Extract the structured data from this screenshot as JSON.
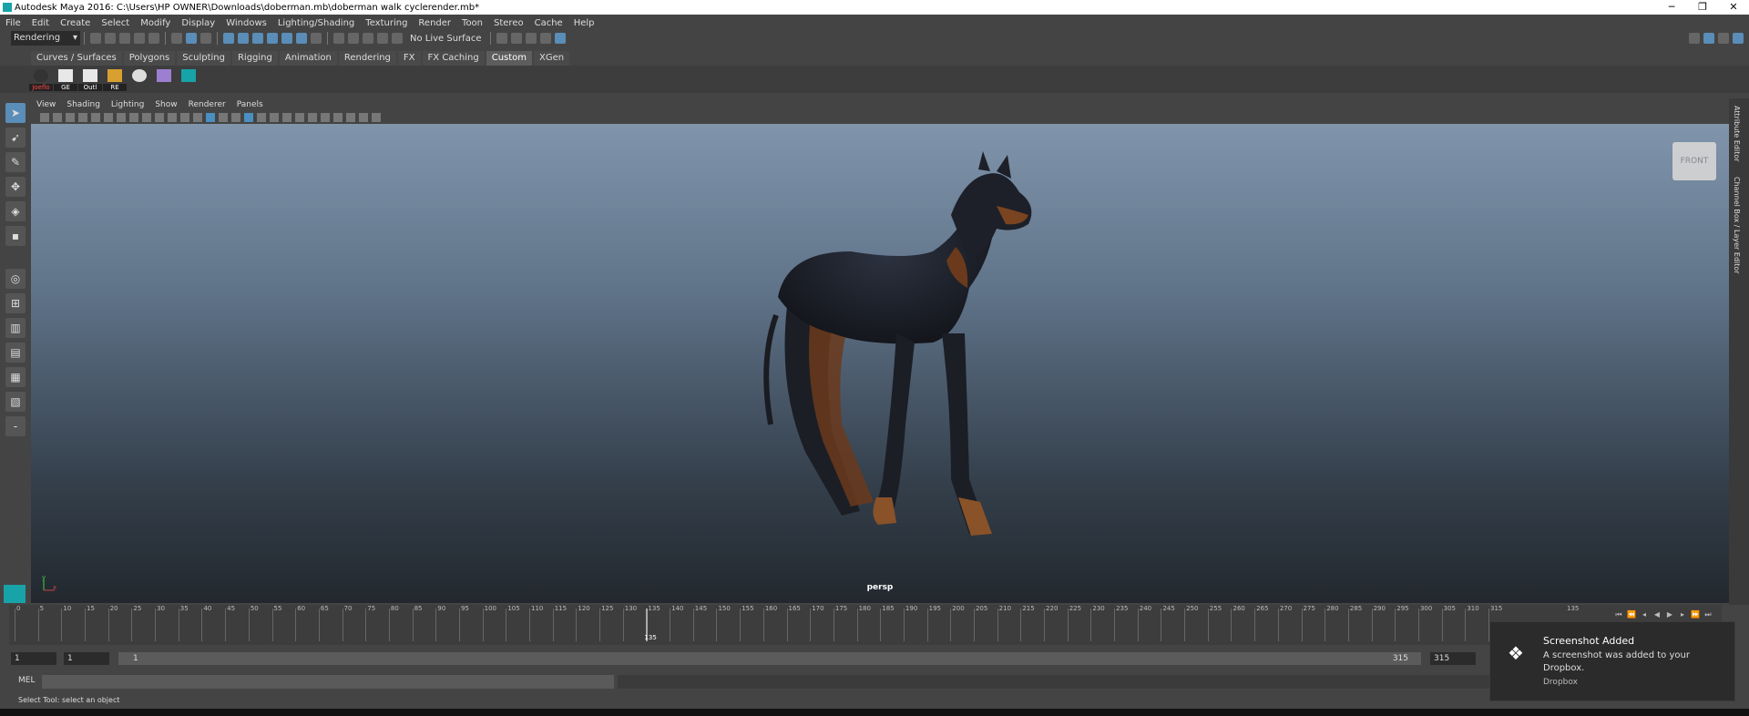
{
  "window": {
    "title": "Autodesk Maya 2016: C:\\Users\\HP OWNER\\Downloads\\doberman.mb\\doberman walk cyclerender.mb*",
    "controls": [
      "─",
      "❐",
      "✕"
    ]
  },
  "menubar": [
    "File",
    "Edit",
    "Create",
    "Select",
    "Modify",
    "Display",
    "Windows",
    "Lighting/Shading",
    "Texturing",
    "Render",
    "Toon",
    "Stereo",
    "Cache",
    "Help"
  ],
  "statusline": {
    "mode": "Rendering",
    "live_surface": "No Live Surface"
  },
  "shelf_tabs": [
    "Curves / Surfaces",
    "Polygons",
    "Sculpting",
    "Rigging",
    "Animation",
    "Rendering",
    "FX",
    "FX Caching",
    "Custom",
    "XGen"
  ],
  "shelf_tab_active": "Custom",
  "shelf_buttons": [
    {
      "label": "Joeflo",
      "color": "#cc2222"
    },
    {
      "label": "GE",
      "color": "#e8e8e8"
    },
    {
      "label": "Outl",
      "color": "#e8e8e8"
    },
    {
      "label": "RE",
      "color": "#d8a030"
    },
    {
      "label": "",
      "color": "#dddddd"
    },
    {
      "label": "",
      "color": "#9c7fd0"
    },
    {
      "label": "",
      "color": "#17a3a8"
    }
  ],
  "panel_menu": [
    "View",
    "Shading",
    "Lighting",
    "Show",
    "Renderer",
    "Panels"
  ],
  "viewport": {
    "camera": "persp",
    "viewcube_label": "FRONT",
    "axis_x": "x",
    "axis_y": "y"
  },
  "right_tabs": [
    "Attribute Editor",
    "Channel Box / Layer Editor"
  ],
  "timeline": {
    "start": 0,
    "end": 315,
    "step": 5,
    "current_frame": 135,
    "current_label": "135",
    "right_label": "135"
  },
  "range": {
    "start_field": "1",
    "start_field2": "1",
    "slider_start": "1",
    "slider_end": "315",
    "end_field": "315"
  },
  "command": {
    "label": "MEL"
  },
  "help_line": "Select Tool: select an object",
  "toast": {
    "title": "Screenshot Added",
    "message": "A screenshot was added to your Dropbox.",
    "source": "Dropbox"
  },
  "colors": {
    "accent": "#5a8db7",
    "maya_teal": "#17a3a8"
  }
}
